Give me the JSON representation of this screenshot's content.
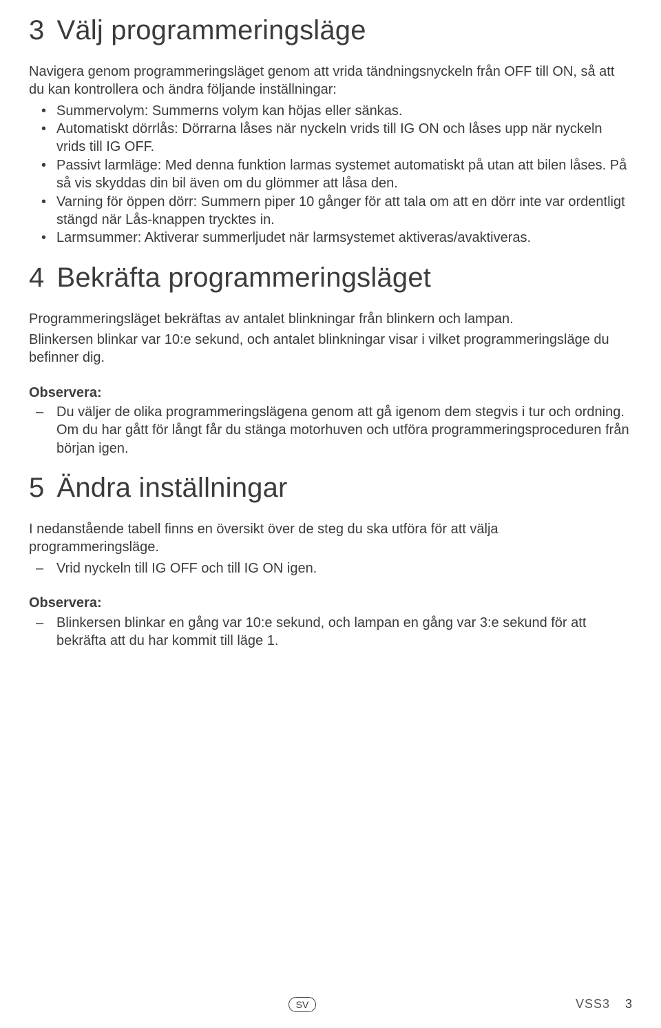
{
  "section3": {
    "num": "3",
    "title": "Välj programmeringsläge",
    "intro": "Navigera genom programmeringsläget genom att vrida tändningsnyckeln från OFF till ON, så att du kan kontrollera och ändra följande inställningar:",
    "bullets": [
      "Summervolym: Summerns volym kan höjas eller sänkas.",
      "Automatiskt dörrlås: Dörrarna låses när nyckeln vrids till IG ON och låses upp när nyckeln vrids till IG OFF.",
      "Passivt larmläge: Med denna funktion larmas systemet automatiskt på utan att bilen låses. På så vis skyddas din bil även om du glömmer att låsa den.",
      "Varning för öppen dörr: Summern piper 10 gånger för att tala om att en dörr inte var ordentligt stängd när Lås-knappen trycktes in.",
      "Larmsummer: Aktiverar summerljudet när larmsystemet aktiveras/avaktiveras."
    ]
  },
  "section4": {
    "num": "4",
    "title": "Bekräfta programmeringsläget",
    "para1": "Programmeringsläget bekräftas av antalet blinkningar från blinkern och lampan.",
    "para2": "Blinkersen blinkar var 10:e sekund, och antalet blinkningar visar i vilket programmeringsläge du befinner dig.",
    "noteLabel": "Observera:",
    "noteItems": [
      "Du väljer de olika programmeringslägena genom att gå igenom dem stegvis i tur och ordning. Om du har gått för långt får du stänga motorhuven och utföra programmeringsproceduren från början igen."
    ]
  },
  "section5": {
    "num": "5",
    "title": "Ändra inställningar",
    "intro": "I nedanstående tabell finns en översikt över de steg du ska utföra för att välja programmeringsläge.",
    "steps": [
      "Vrid nyckeln till IG OFF och till IG ON igen."
    ],
    "noteLabel": "Observera:",
    "noteItems": [
      "Blinkersen blinkar en gång var 10:e sekund, och lampan en gång var 3:e sekund för att bekräfta att du har kommit till läge 1."
    ]
  },
  "footer": {
    "lang": "SV",
    "doc": "VSS3",
    "page": "3"
  }
}
